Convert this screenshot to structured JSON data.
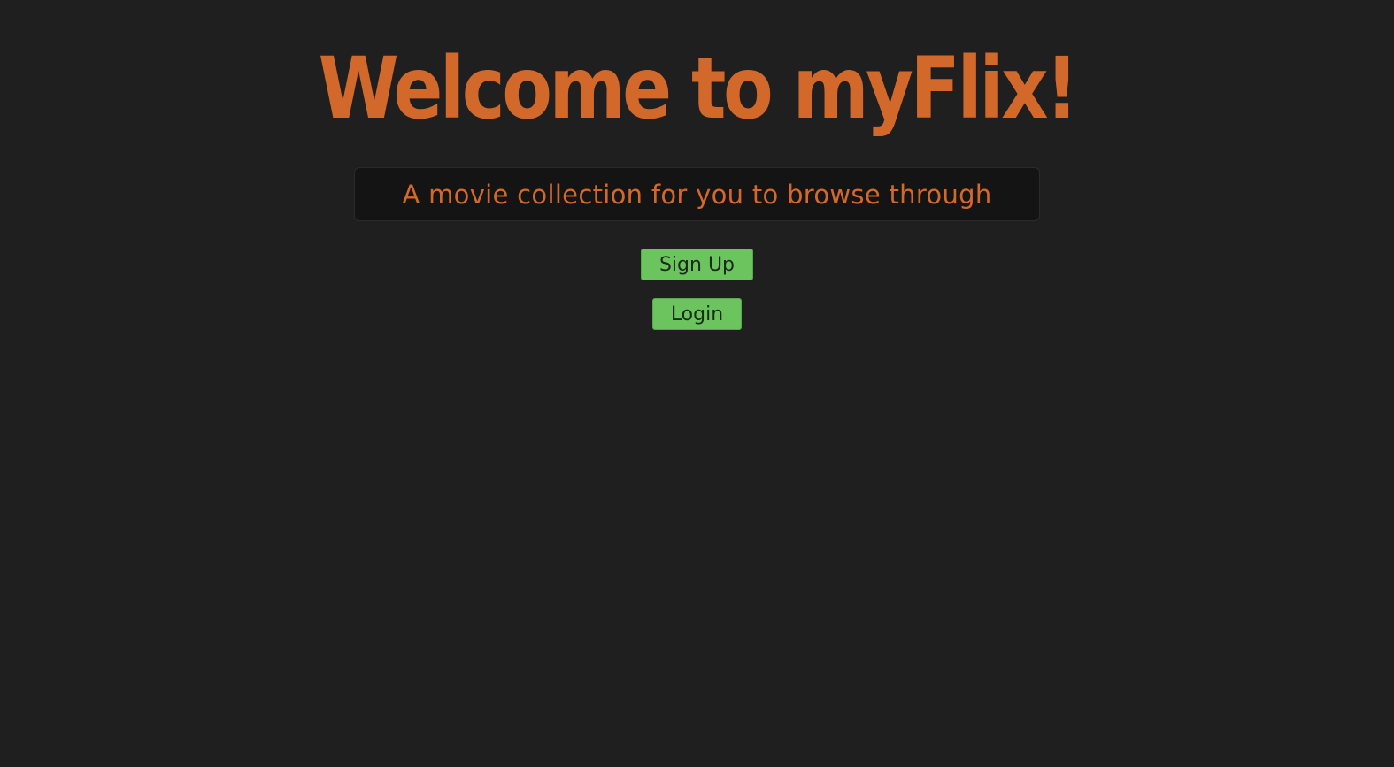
{
  "header": {
    "title": "Welcome to myFlix!"
  },
  "hero": {
    "subtitle": "A movie collection for you to browse through"
  },
  "actions": {
    "signup_label": "Sign Up",
    "login_label": "Login"
  },
  "colors": {
    "background": "#1f1f1f",
    "accent": "#d2692a",
    "button": "#6cc45f"
  }
}
